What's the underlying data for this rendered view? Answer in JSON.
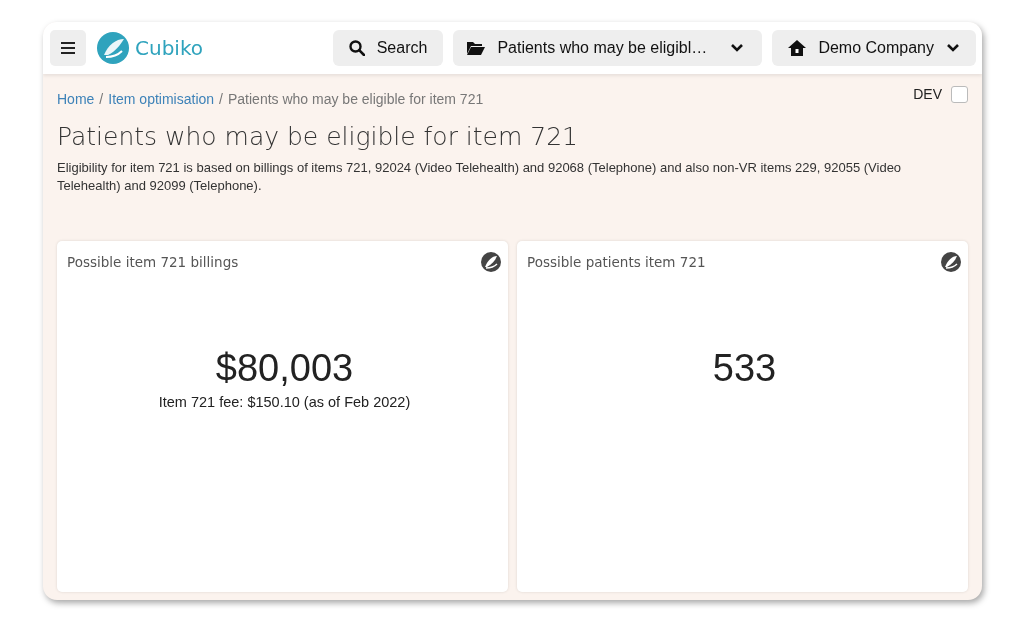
{
  "header": {
    "brand": "Cubiko",
    "search_button": "Search",
    "report_dropdown": "Patients who may be eligibl…",
    "company_dropdown": "Demo Company"
  },
  "breadcrumbs": [
    {
      "label": "Home",
      "kind": "link"
    },
    {
      "label": "/",
      "kind": "separator"
    },
    {
      "label": "Item optimisation",
      "kind": "link"
    },
    {
      "label": "/",
      "kind": "separator"
    },
    {
      "label": "Patients who may be eligible for item 721",
      "kind": "current"
    }
  ],
  "dev_toggle": {
    "label": "DEV",
    "checked": false
  },
  "page": {
    "title": "Patients who may be eligible for item 721",
    "description": "Eligibility for item 721 is based on billings of items 721, 92024 (Video Telehealth) and 92068 (Telephone) and also non-VR items 229, 92055 (Video Telehealth) and 92099 (Telephone)."
  },
  "cards": [
    {
      "title": "Possible item 721 billings",
      "value": "$80,003",
      "note": "Item 721 fee: $150.10 (as of Feb 2022)"
    },
    {
      "title": "Possible patients item 721",
      "value": "533"
    }
  ]
}
